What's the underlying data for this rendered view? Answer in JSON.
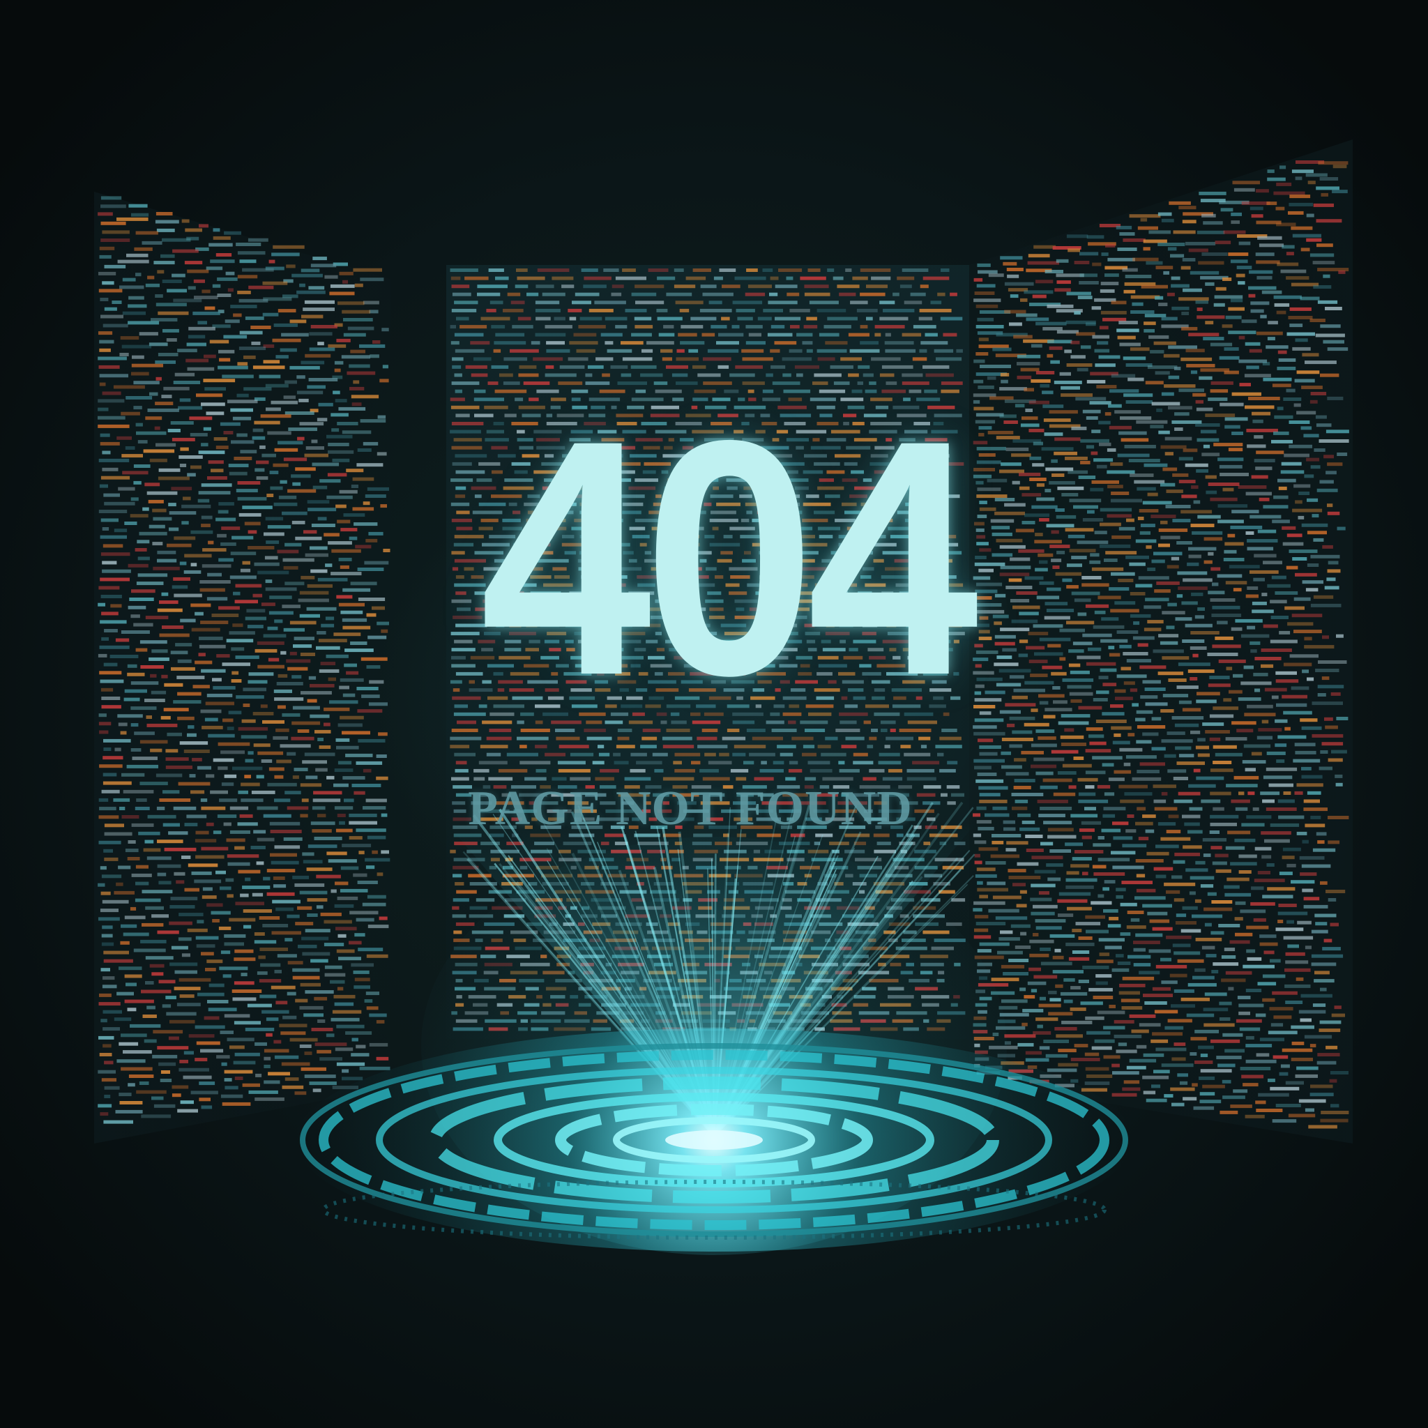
{
  "error": {
    "code": "404",
    "message": "PAGE NOT FOUND"
  },
  "colors": {
    "background": "#0a1416",
    "headline": "#bff1f1",
    "subtitle": "#5f9aa3",
    "hologram": "#37e3f0",
    "code_palette": [
      "#4fa3ad",
      "#6fb6c0",
      "#c96b2b",
      "#d88a3a",
      "#c23b3b",
      "#5e8f9a",
      "#9fb7bf",
      "#3a7f8c"
    ]
  },
  "icons": {
    "projector": "hologram-projector-icon",
    "beam": "light-beam"
  }
}
